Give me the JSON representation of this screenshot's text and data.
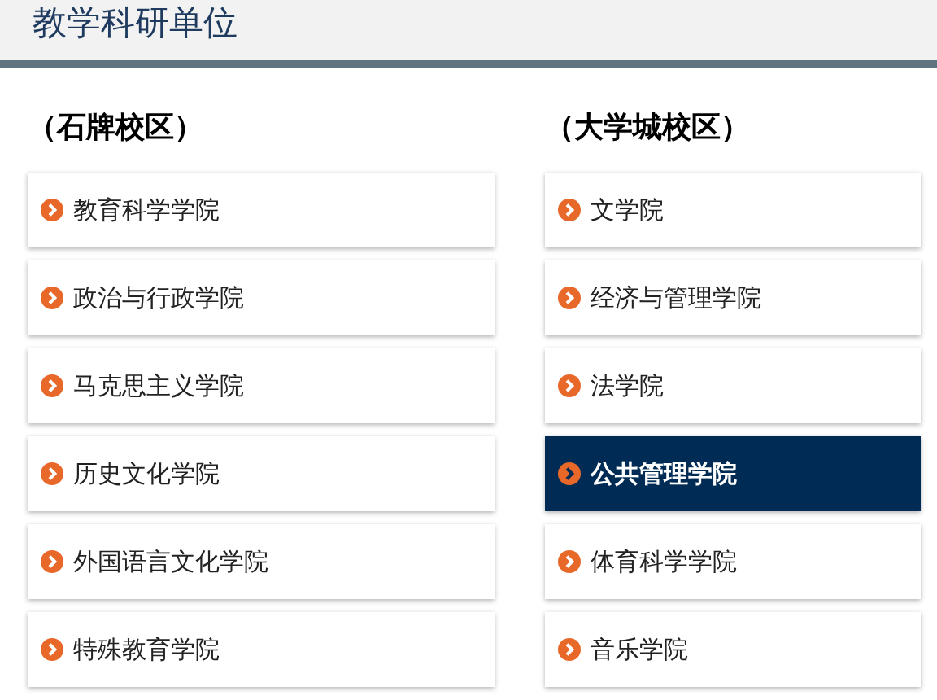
{
  "header": {
    "title": "教学科研单位"
  },
  "campuses": [
    {
      "name": "（石牌校区）",
      "units": [
        {
          "label": "教育科学学院",
          "selected": false
        },
        {
          "label": "政治与行政学院",
          "selected": false
        },
        {
          "label": "马克思主义学院",
          "selected": false
        },
        {
          "label": "历史文化学院",
          "selected": false
        },
        {
          "label": "外国语言文化学院",
          "selected": false
        },
        {
          "label": "特殊教育学院",
          "selected": false
        }
      ]
    },
    {
      "name": "（大学城校区）",
      "units": [
        {
          "label": "文学院",
          "selected": false
        },
        {
          "label": "经济与管理学院",
          "selected": false
        },
        {
          "label": "法学院",
          "selected": false
        },
        {
          "label": "公共管理学院",
          "selected": true
        },
        {
          "label": "体育科学学院",
          "selected": false
        },
        {
          "label": "音乐学院",
          "selected": false
        }
      ]
    }
  ]
}
